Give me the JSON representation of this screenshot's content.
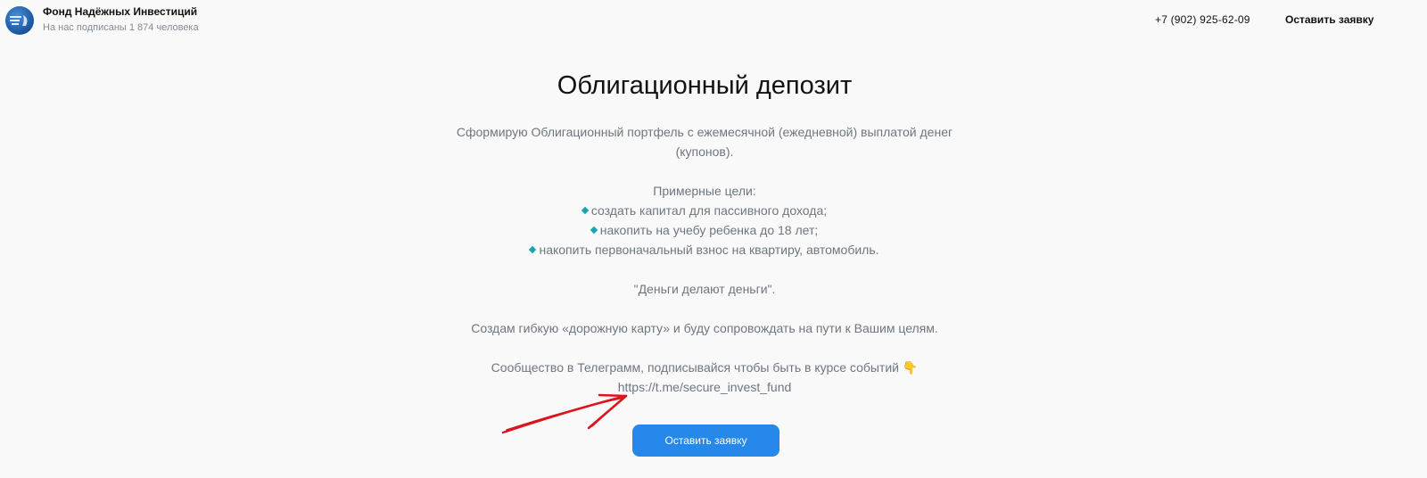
{
  "header": {
    "avatar_icon": "fund-logo-icon",
    "community_name": "Фонд Надёжных Инвестиций",
    "subscribers": "На нас подписаны 1 874 человека",
    "phone": "+7 (902) 925-62-09",
    "cta_label": "Оставить заявку"
  },
  "main": {
    "title": "Облигационный депозит",
    "intro": "Сформирую Облигационный портфель с ежемесячной (ежедневной) выплатой денег (купонов).",
    "goals_heading": "Примерные цели:",
    "goals": [
      "создать капитал для пассивного дохода;",
      "накопить на учебу ребенка до 18 лет;",
      "накопить первоначальный взнос на квартиру, автомобиль."
    ],
    "quote": "\"Деньги делают деньги\".",
    "roadmap": "Создам гибкую «дорожную карту» и буду сопровождать на пути к Вашим целям.",
    "telegram_text": "Сообщество в Телеграмм, подписывайся чтобы быть в курсе событий 👇",
    "telegram_link": "https://t.me/secure_invest_fund",
    "cta_label": "Оставить заявку"
  },
  "colors": {
    "accent": "#2688eb",
    "bullet": "#1aa3b5",
    "arrow": "#d9161c",
    "text_muted": "#6f7680"
  }
}
